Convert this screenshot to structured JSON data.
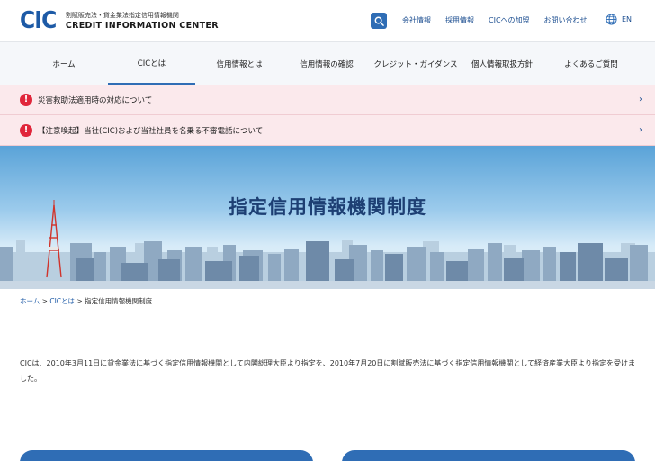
{
  "header": {
    "logo_mark": "CIC",
    "logo_sub": "割賦販売法・貸金業法指定信用情報機関",
    "logo_main": "CREDIT INFORMATION CENTER",
    "top_links": [
      "会社情報",
      "採用情報",
      "CICへの加盟",
      "お問い合わせ"
    ],
    "lang_label": "EN"
  },
  "nav": {
    "items": [
      "ホーム",
      "CICとは",
      "信用情報とは",
      "信用情報の確認",
      "クレジット・ガイダンス",
      "個人情報取扱方針",
      "よくあるご質問"
    ],
    "active_index": 1
  },
  "alerts": [
    {
      "text": "災害救助法適用時の対応について"
    },
    {
      "text": "【注意喚起】当社(CIC)および当社社員を名乗る不審電話について"
    }
  ],
  "hero": {
    "title": "指定信用情報機関制度"
  },
  "breadcrumb": {
    "home": "ホーム",
    "sep1": " > ",
    "cic": "CICとは",
    "sep2": " > ",
    "current": "指定信用情報機関制度"
  },
  "body_text": "CICは、2010年3月11日に貸金業法に基づく指定信用情報機関として内閣総理大臣より指定を、2010年7月20日に割賦販売法に基づく指定信用情報機関として経済産業大臣より指定を受けました。",
  "colors": {
    "brand": "#2f6db5",
    "alert_bg": "#fbe9ec",
    "alert_icon": "#e0263b",
    "hero_title": "#1d3f73"
  }
}
